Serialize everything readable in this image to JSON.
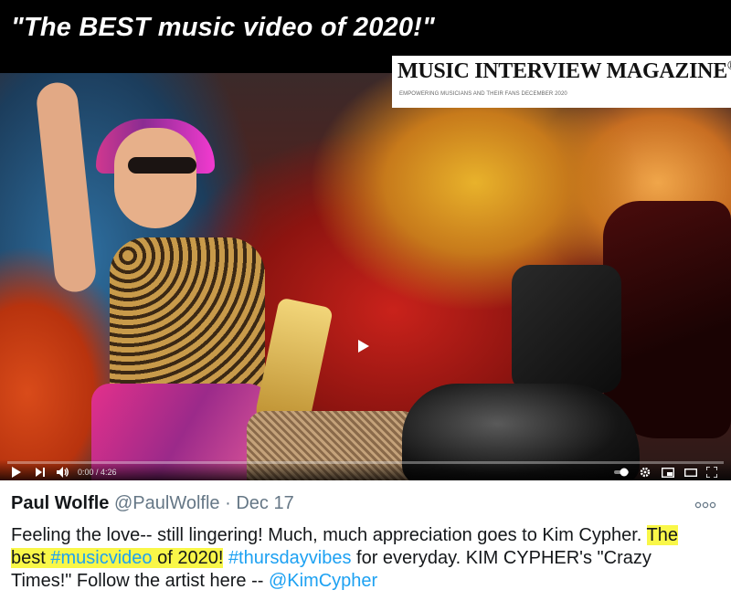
{
  "banner": {
    "quote": "\"The BEST music video of 2020!\""
  },
  "magazine": {
    "title": "MUSIC INTERVIEW MAGAZINE",
    "registered": "®",
    "subtitle": "EMPOWERING MUSICIANS AND THEIR FANS DECEMBER 2020"
  },
  "player": {
    "time": "0:00 / 4:26",
    "progress_fraction": 0.0,
    "colors": {
      "progress": "#ff0000"
    },
    "icons": [
      "play-icon",
      "next-icon",
      "volume-icon",
      "autoplay-toggle-icon",
      "settings-icon",
      "miniplayer-icon",
      "theater-icon",
      "fullscreen-icon"
    ]
  },
  "tweet": {
    "name": "Paul Wolfle",
    "handle": "@PaulWolfle",
    "separator": "·",
    "date": "Dec 17",
    "more_icon": "more-options-icon",
    "text_1": "Feeling the love-- still lingering! Much, much appreciation goes to Kim Cypher. ",
    "highlight_1": "The best ",
    "hashtag_1": "#musicvideo",
    "highlight_2": " of 2020!",
    "text_2": " ",
    "hashtag_2": "#thursdayvibes",
    "text_3": " for everyday. KIM CYPHER's \"Crazy Times!\" Follow the artist here -- ",
    "mention": "@KimCypher",
    "colors": {
      "link": "#1da1f2",
      "highlight": "#f9f748",
      "text": "#14171a",
      "muted": "#657786"
    }
  }
}
